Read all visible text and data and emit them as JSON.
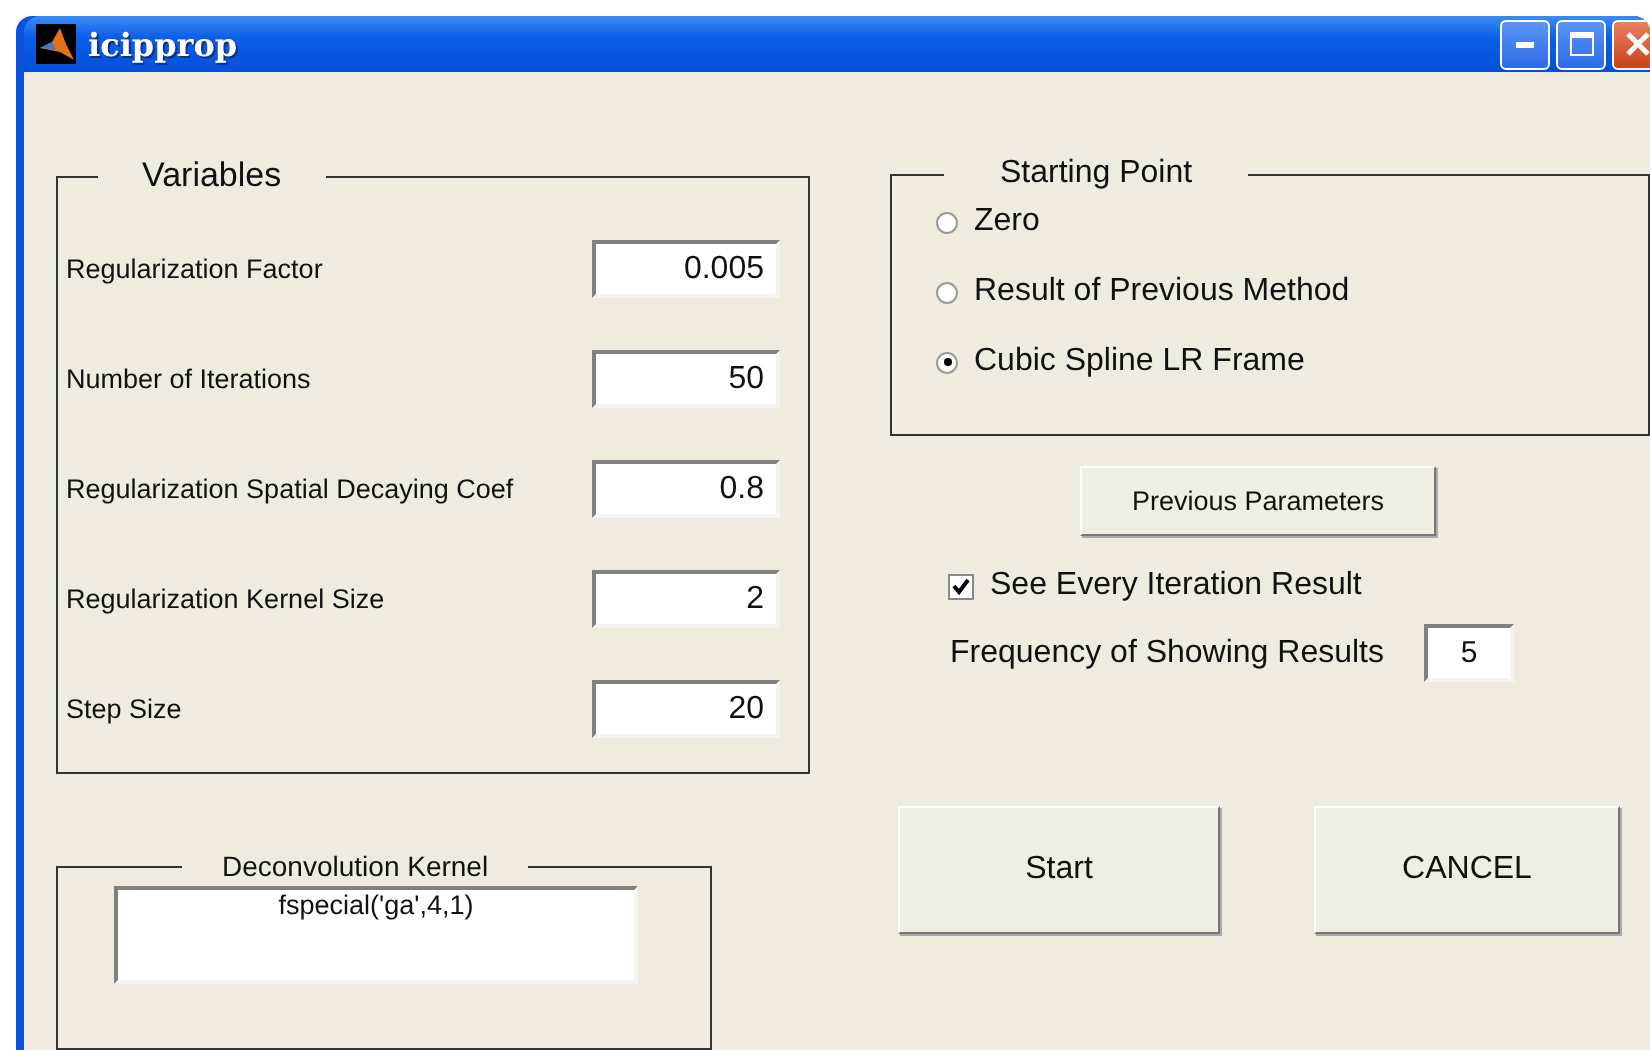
{
  "window": {
    "title": "icipprop"
  },
  "variables": {
    "title": "Variables",
    "fields": [
      {
        "label": "Regularization Factor",
        "value": "0.005"
      },
      {
        "label": "Number of Iterations",
        "value": "50"
      },
      {
        "label": "Regularization Spatial Decaying Coef",
        "value": "0.8"
      },
      {
        "label": "Regularization Kernel Size",
        "value": "2"
      },
      {
        "label": "Step Size",
        "value": "20"
      }
    ]
  },
  "starting_point": {
    "title": "Starting Point",
    "options": [
      {
        "label": "Zero",
        "selected": false
      },
      {
        "label": "Result of Previous Method",
        "selected": false
      },
      {
        "label": "Cubic Spline LR Frame",
        "selected": true
      }
    ]
  },
  "previous_parameters_button": "Previous Parameters",
  "see_every_iteration": {
    "label": "See Every Iteration Result",
    "checked": true
  },
  "frequency": {
    "label": "Frequency of Showing Results",
    "value": "5"
  },
  "deconvolution_kernel": {
    "title": "Deconvolution Kernel",
    "value": "fspecial('ga',4,1)"
  },
  "buttons": [
    "Start",
    "CANCEL"
  ]
}
